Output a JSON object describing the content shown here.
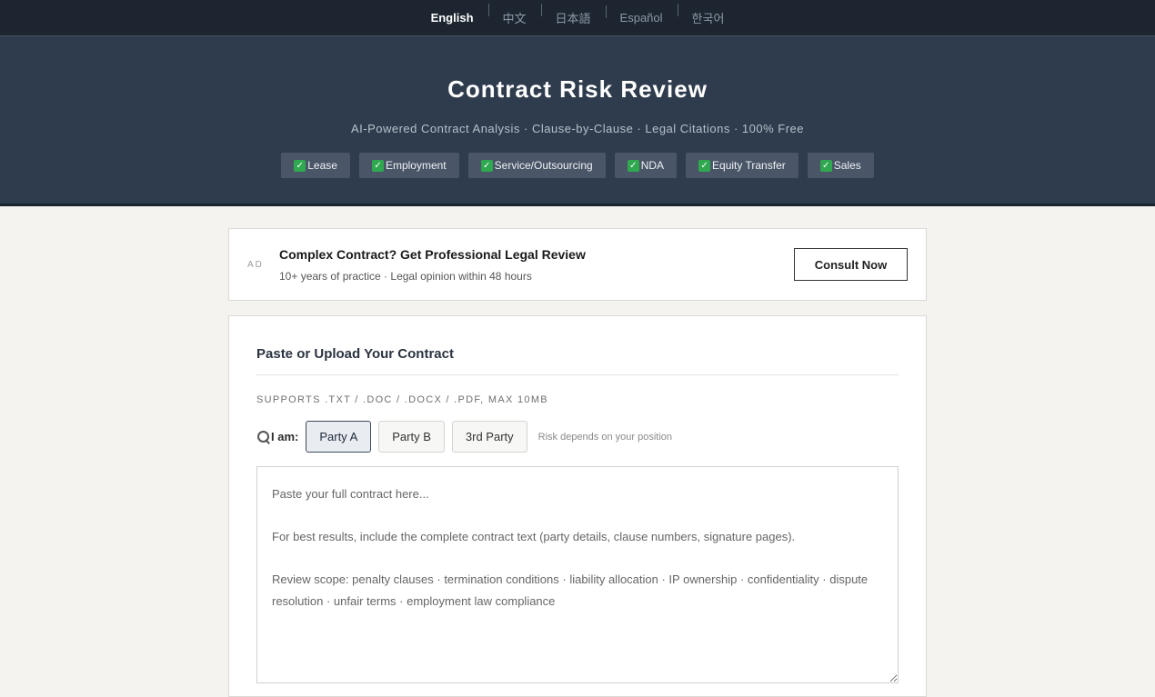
{
  "languages": [
    {
      "label": "English",
      "active": true
    },
    {
      "label": "中文",
      "active": false
    },
    {
      "label": "日本語",
      "active": false
    },
    {
      "label": "Español",
      "active": false
    },
    {
      "label": "한국어",
      "active": false
    }
  ],
  "hero": {
    "title": "Contract Risk Review",
    "subtitle": "AI-Powered Contract Analysis · Clause-by-Clause · Legal Citations · 100% Free",
    "tags": [
      "Lease",
      "Employment",
      "Service/Outsourcing",
      "NDA",
      "Equity Transfer",
      "Sales"
    ],
    "tag_icon": "check-mark-icon"
  },
  "ad": {
    "label": "AD",
    "title": "Complex Contract? Get Professional Legal Review",
    "description": "10+ years of practice · Legal opinion within 48 hours",
    "button": "Consult Now"
  },
  "form": {
    "title": "Paste or Upload Your Contract",
    "formats": "SUPPORTS .TXT / .DOC / .DOCX / .PDF, MAX 10MB",
    "iam_label": "I am:",
    "parties": [
      "Party A",
      "Party B",
      "3rd Party"
    ],
    "selected_party": "Party A",
    "hint": "Risk depends on your position",
    "textarea_placeholder": "Paste your full contract here...\n\nFor best results, include the complete contract text (party details, clause numbers, signature pages).\n\nReview scope: penalty clauses · termination conditions · liability allocation · IP ownership · confidentiality · dispute resolution · unfair terms · employment law compliance"
  },
  "colors": {
    "header_bg": "#1c2530",
    "hero_bg": "#2f3c4d",
    "tag_bg": "#4a5667",
    "check_green": "#2fa84f",
    "page_bg": "#f4f3ef"
  }
}
